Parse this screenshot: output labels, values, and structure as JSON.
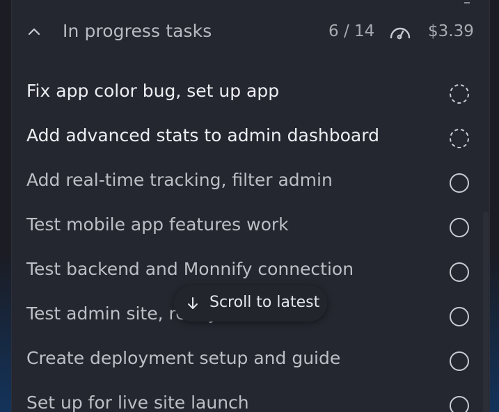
{
  "header": {
    "title": "In progress tasks",
    "task_count": "6 / 14",
    "cost": "$3.39"
  },
  "tasks": [
    {
      "label": "Fix app color bug, set up app",
      "status": "in-progress"
    },
    {
      "label": "Add advanced stats to admin dashboard",
      "status": "in-progress"
    },
    {
      "label": "Add real-time tracking, filter admin",
      "status": "pending"
    },
    {
      "label": "Test mobile app features work",
      "status": "pending"
    },
    {
      "label": "Test backend and Monnify connection",
      "status": "pending"
    },
    {
      "label": "Test admin site, ready for use",
      "status": "pending"
    },
    {
      "label": "Create deployment setup and guide",
      "status": "pending"
    },
    {
      "label": "Set up for live site launch",
      "status": "pending"
    }
  ],
  "scroll_to_latest": {
    "label": "Scroll to latest"
  },
  "icons": {
    "collapse": "chevron-up-icon",
    "speed": "speedometer-icon",
    "in_progress": "dashed-circle-icon",
    "pending": "circle-icon",
    "scroll": "arrow-down-icon"
  },
  "colors": {
    "panel": "#252730",
    "text_active": "#eceef2",
    "text_muted": "#bdbfc6"
  }
}
